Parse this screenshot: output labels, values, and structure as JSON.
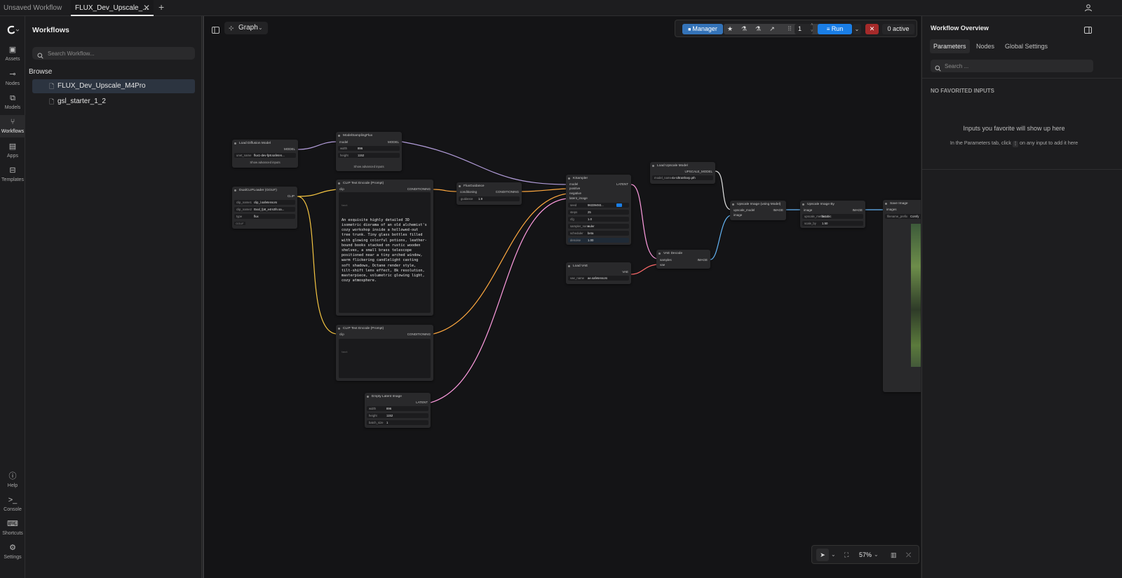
{
  "tabs": [
    {
      "label": "Unsaved Workflow"
    },
    {
      "label": "FLUX_Dev_Upscale_..."
    }
  ],
  "rail": [
    {
      "label": "Assets"
    },
    {
      "label": "Nodes"
    },
    {
      "label": "Models"
    },
    {
      "label": "Workflows"
    },
    {
      "label": "Apps"
    },
    {
      "label": "Templates"
    },
    {
      "label": "Help"
    },
    {
      "label": "Console"
    },
    {
      "label": "Shortcuts"
    },
    {
      "label": "Settings"
    }
  ],
  "workflows_panel": {
    "title": "Workflows",
    "search_placeholder": "Search Workflow...",
    "browse_label": "Browse",
    "items": [
      {
        "label": "FLUX_Dev_Upscale_M4Pro"
      },
      {
        "label": "gsl_starter_1_2"
      }
    ]
  },
  "canvas": {
    "view_mode": "Graph",
    "toolbar": {
      "manager": "Manager",
      "queue_count": "1",
      "run": "Run",
      "active": "0 active"
    },
    "zoom": "57%"
  },
  "nodes": {
    "load_diffusion": {
      "title": "Load Diffusion Model",
      "out": "MODEL",
      "w_label": "unet_name",
      "w_val": "flux1-dev-fp8.safeten...",
      "adv": "Show advanced inputs"
    },
    "model_sampling": {
      "title": "ModelSamplingFlux",
      "in": "model",
      "out": "MODEL",
      "w1_label": "width",
      "w1_val": "896",
      "w2_label": "height",
      "w2_val": "1152",
      "adv": "Show advanced inputs"
    },
    "dualclip": {
      "title": "DualCLIPLoader (GGUF)",
      "out": "CLIP",
      "w1_label": "clip_name1",
      "w1_val": "clip_l.safetensors",
      "w2_label": "clip_name2",
      "w2_val": "t5xxl_fp8_e4m3fn.sa...",
      "w3_label": "type",
      "w3_val": "flux",
      "badge": "GGUF"
    },
    "clip_pos": {
      "title": "CLIP Text Encode (Prompt)",
      "in": "clip",
      "out": "CONDITIONING",
      "hint": "text",
      "prompt": "An exquisite highly detailed 3D isometric diorama of an old alchemist's cozy workshop inside a hollowed-out tree trunk. Tiny glass bottles filled with glowing colorful potions, leather-bound books stacked on rustic wooden shelves, a small brass telescope positioned near a tiny arched window, warm flickering candlelight casting soft shadows, Octane render style, tilt-shift lens effect, 8k resolution, masterpiece, volumetric glowing light, cozy atmosphere."
    },
    "clip_neg": {
      "title": "CLIP Text Encode (Prompt)",
      "in": "clip",
      "out": "CONDITIONING",
      "hint": "text"
    },
    "flux_guidance": {
      "title": "FluxGuidance",
      "in": "conditioning",
      "out": "CONDITIONING",
      "w_label": "guidance",
      "w_val": "1.9"
    },
    "ksampler": {
      "title": "KSampler",
      "in1": "model",
      "in2": "positive",
      "in3": "negative",
      "in4": "latent_image",
      "out": "LATENT",
      "seed_label": "seed",
      "seed_val": "96339493...",
      "steps_label": "steps",
      "steps_val": "25",
      "cfg_label": "cfg",
      "cfg_val": "1.0",
      "sampler_label": "sampler_name",
      "sampler_val": "euler",
      "sched_label": "scheduler",
      "sched_val": "beta",
      "denoise_label": "denoise",
      "denoise_val": "1.00"
    },
    "empty_latent": {
      "title": "Empty Latent Image",
      "out": "LATENT",
      "w1_label": "width",
      "w1_val": "896",
      "w2_label": "height",
      "w2_val": "1152",
      "w3_label": "batch_size",
      "w3_val": "1"
    },
    "load_vae": {
      "title": "Load VAE",
      "out": "VAE",
      "w_label": "vae_name",
      "w_val": "ae.safetensors"
    },
    "load_upscale": {
      "title": "Load Upscale Model",
      "out": "UPSCALE_MODEL",
      "w_label": "model_name",
      "w_val": "4x-UltraSharp.pth"
    },
    "vae_decode": {
      "title": "VAE Decode",
      "in1": "samples",
      "in2": "vae",
      "out": "IMAGE"
    },
    "upscale_model": {
      "title": "Upscale Image (using Model)",
      "in1": "upscale_model",
      "in2": "image",
      "out": "IMAGE"
    },
    "upscale_by": {
      "title": "Upscale Image By",
      "in": "image",
      "out": "IMAGE",
      "w1_label": "upscale_method",
      "w1_val": "bicubic",
      "w2_label": "scale_by",
      "w2_val": "1.50"
    },
    "save_image": {
      "title": "Save Image",
      "in": "images",
      "w_label": "filename_prefix",
      "w_val": "Comfy"
    }
  },
  "overview": {
    "title": "Workflow Overview",
    "tabs": [
      {
        "label": "Parameters"
      },
      {
        "label": "Nodes"
      },
      {
        "label": "Global Settings"
      }
    ],
    "search_placeholder": "Search ...",
    "section": "NO FAVORITED INPUTS",
    "empty_title": "Inputs you favorite will show up here",
    "empty_desc_a": "In the Parameters tab, click",
    "empty_desc_b": "on any input to add it here"
  },
  "colors": {
    "accent": "#1a7ee6",
    "wire_model": "#b39ddb",
    "wire_clip": "#f5c542",
    "wire_cond": "#ffa940",
    "wire_latent": "#ff9ce0",
    "wire_vae": "#ff6b6b",
    "wire_image": "#64b5f6"
  }
}
